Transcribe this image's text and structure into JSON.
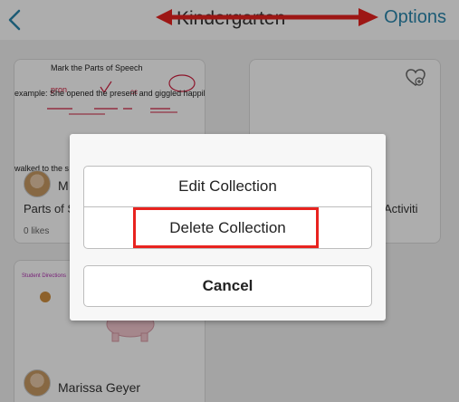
{
  "header": {
    "title": "Kindergarten",
    "options_label": "Options"
  },
  "cards": [
    {
      "worksheet_title": "Mark the Parts of Speech",
      "worksheet_example": "example:  She opened the present and giggled happily.",
      "worksheet_bottom": "walked to the s",
      "author": "M",
      "name": "Parts of S",
      "likes": "0 likes"
    },
    {
      "name": "Activiti"
    },
    {
      "header_text": "Student Directions",
      "author": "Marissa Geyer"
    }
  ],
  "dialog": {
    "edit_label": "Edit Collection",
    "delete_label": "Delete Collection",
    "cancel_label": "Cancel"
  },
  "colors": {
    "accent": "#2a86ad",
    "annotation": "#e8231f"
  }
}
